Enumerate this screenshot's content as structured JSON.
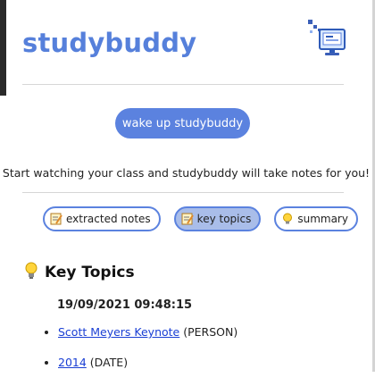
{
  "app": {
    "name": "studybuddy"
  },
  "header": {
    "logo_icon": "computer-monitor-icon"
  },
  "actions": {
    "wake_label": "wake up studybuddy"
  },
  "tagline": "Start watching your class and studybuddy will take notes for you!",
  "tabs": [
    {
      "label": "extracted notes",
      "icon": "memo-icon",
      "active": false
    },
    {
      "label": "key topics",
      "icon": "memo-icon",
      "active": true
    },
    {
      "label": "summary",
      "icon": "lightbulb-icon",
      "active": false
    }
  ],
  "section": {
    "title": "Key Topics",
    "icon": "lightbulb-icon"
  },
  "timestamp": "19/09/2021 09:48:15",
  "topics": [
    {
      "text": "Scott Meyers Keynote",
      "type": "(PERSON)"
    },
    {
      "text": "2014",
      "type": "(DATE)"
    }
  ],
  "colors": {
    "accent": "#5b82df",
    "brand": "#5680db",
    "active_tab": "#a9bde9"
  }
}
